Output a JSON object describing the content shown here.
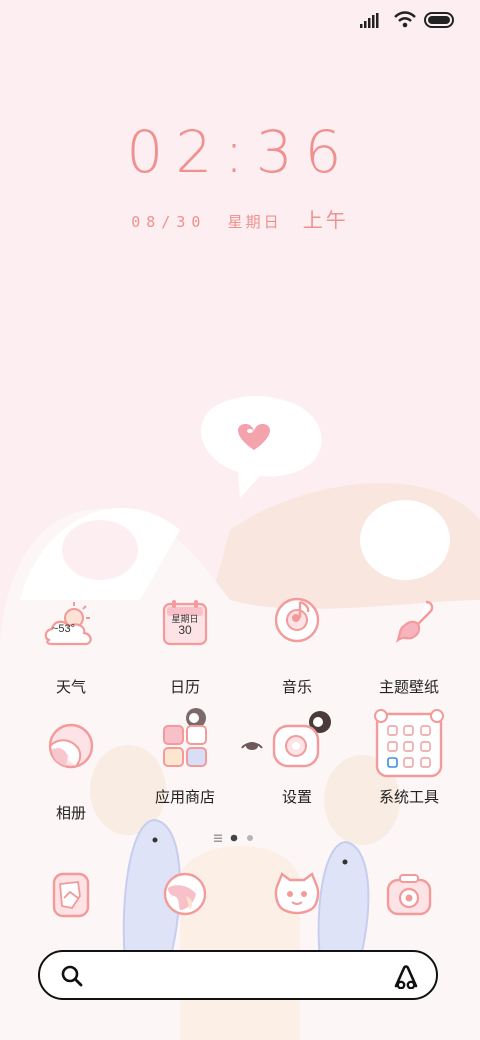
{
  "status": {
    "signal_icon": "signal-icon",
    "wifi_icon": "wifi-icon",
    "battery_icon": "battery-icon"
  },
  "clock": {
    "time": "02:36",
    "date": "08/30",
    "weekday": "星期日",
    "ampm": "上午"
  },
  "apps_row1": [
    {
      "label": "天气",
      "icon": "weather-icon",
      "temp": "~53°"
    },
    {
      "label": "日历",
      "icon": "calendar-icon",
      "cal_weekday": "星期日",
      "cal_day": "30"
    },
    {
      "label": "音乐",
      "icon": "music-icon"
    },
    {
      "label": "主题壁纸",
      "icon": "brush-icon"
    }
  ],
  "apps_row2": [
    {
      "label": "相册",
      "icon": "gallery-icon"
    },
    {
      "label": "应用商店",
      "icon": "app-store-icon"
    },
    {
      "label": "设置",
      "icon": "settings-icon"
    },
    {
      "label": "系统工具",
      "icon": "tools-icon"
    }
  ],
  "dock": [
    {
      "icon": "message-icon"
    },
    {
      "icon": "browser-icon"
    },
    {
      "icon": "cat-phone-icon"
    },
    {
      "icon": "camera-icon"
    }
  ],
  "page_indicator": {
    "pages": 3,
    "active": 1
  },
  "search": {
    "icon": "search-icon",
    "assistant_icon": "assistant-icon"
  },
  "colors": {
    "accent": "#f0908f",
    "outline": "#f39a9a",
    "bg": "#fdeef1"
  }
}
